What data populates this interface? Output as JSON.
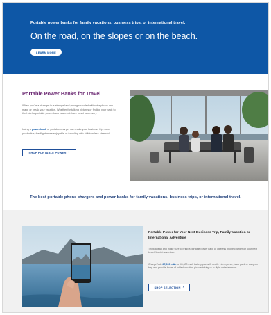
{
  "hero": {
    "eyebrow": "Portable power banks for family vacations, business trips, or international travel.",
    "title": "On the road, on the slopes or on the beach.",
    "button": "LEARN MORE"
  },
  "section1": {
    "title": "Portable Power Banks for Travel",
    "p1": "When you're a stranger in a strange land (along stranded without a phone can make or break your vacation. Whether for talking pictures or finding your back to the hotel a portable power bank is a must-have travel accessory.",
    "p2_pre": "Using a ",
    "p2_link": "power bank",
    "p2_post": " or portable charger can make your business trip more productive, the flight more enjoyable or traveling with children less stressful.",
    "button": "SHOP PORTABLE POWER",
    "button_arrow": "›"
  },
  "banner": "The best portable phone chargers and power banks for family vacations, business trips, or international travel.",
  "section2": {
    "title": "Portable Power for Your Next Business Trip, Family Vacation or International Adventure",
    "p1": "Think ahead and make sure to bring a portable power pack or wireless phone charger on your next beach/tourist adventure.",
    "p2_pre": "ChargeTech ",
    "p2_hl": "27,000 mAh",
    "p2_post": " or 45,000 mAh battery packs fit neatly into a purse, back pack or carry-on bag and provide hours of added vacation picture taking or in-flight entertainment.",
    "button": "SHOP SELECTION",
    "button_arrow": "›"
  },
  "colors": {
    "hero_bg": "#0e57a6",
    "accent_purple": "#6d2b74",
    "banner_text": "#1f3f7a"
  }
}
